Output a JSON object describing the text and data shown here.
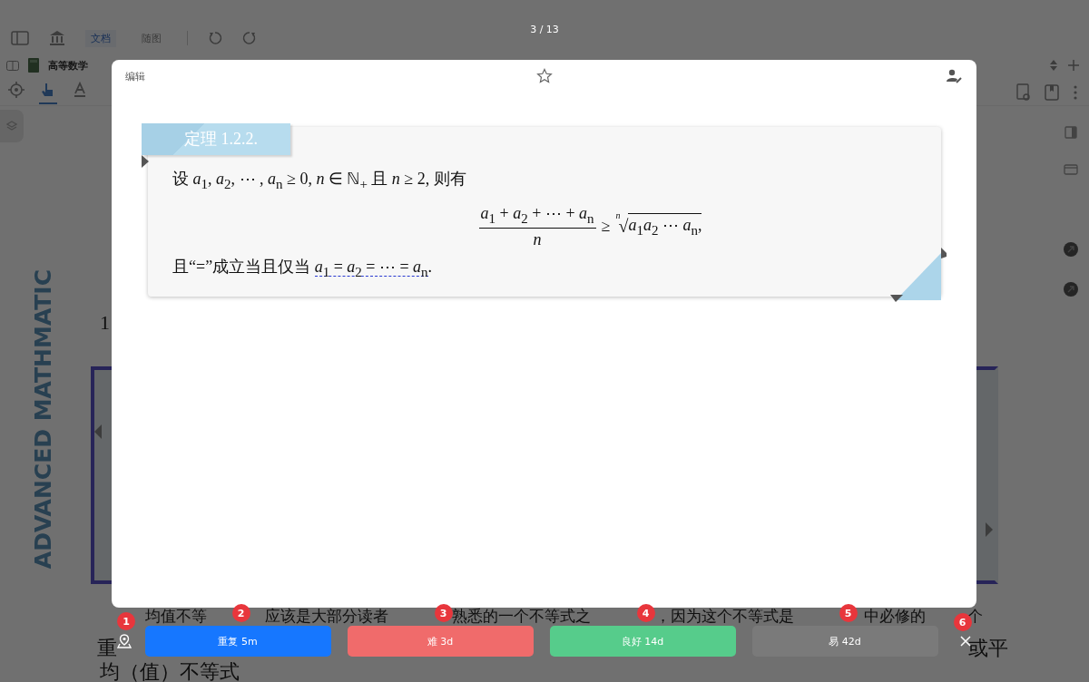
{
  "toolbar": {
    "tabs": [
      {
        "label": "文档",
        "selected": true
      },
      {
        "label": "随图",
        "selected": false
      }
    ]
  },
  "notebook": {
    "title": "高等数学"
  },
  "tools": [
    {
      "kind": "target",
      "selected": false
    },
    {
      "kind": "hand",
      "selected": true
    },
    {
      "kind": "text",
      "selected": false
    }
  ],
  "page_counter": "3 / 13",
  "document": {
    "lines": [
      "1"
    ],
    "cover_title": "ADVANCED MATHMATIC",
    "paragraph": {
      "line_1_parts": [
        "均值不等",
        "应该是大部分读者",
        "熟悉的一个不等式之",
        "，因为这个不等式是",
        "中必修的",
        "个"
      ],
      "line_2_start": "重",
      "line_2_end": "或平",
      "line_3": "均（值）不等式"
    }
  },
  "dialog": {
    "title": "编辑",
    "starred": false,
    "theorem": {
      "tag": "定理 1.2.2.",
      "statement": "设 *a*$_{1}$, *a*$_{2}$, ⋯ , *a*$_{n}$ ≥ 0, *n* ∈ ℕ$_{+}$ 且 *n* ≥ 2, 则有",
      "numerator": "*a*$_{1}$ + *a*$_{2}$ + ⋯ + *a*$_{n}$",
      "denominator": "*n*",
      "relation": "≥",
      "root_index": "*n*",
      "radical": "√",
      "radicand": "*a*$_{1}$*a*$_{2}$ ⋯ *a*$_{n}$,",
      "condition_prefix": "且“=”成立当且仅当 ",
      "condition_link": "*a*$_{1}$ = *a*$_{2}$ = ⋯ = *a*$_{n}$",
      "condition_suffix": "."
    }
  },
  "actions": [
    {
      "kind": "locate",
      "badge": "1"
    },
    {
      "kind": "button",
      "label": "重复 5m",
      "badge": "2",
      "color": "#1677ff"
    },
    {
      "kind": "button",
      "label": "难 3d",
      "badge": "3",
      "color": "#f06b6b"
    },
    {
      "kind": "button",
      "label": "良好 14d",
      "badge": "4",
      "color": "#56cc8b"
    },
    {
      "kind": "button",
      "label": "易 42d",
      "badge": "5",
      "color": "#7a7a7a"
    },
    {
      "kind": "close",
      "badge": "6"
    }
  ]
}
